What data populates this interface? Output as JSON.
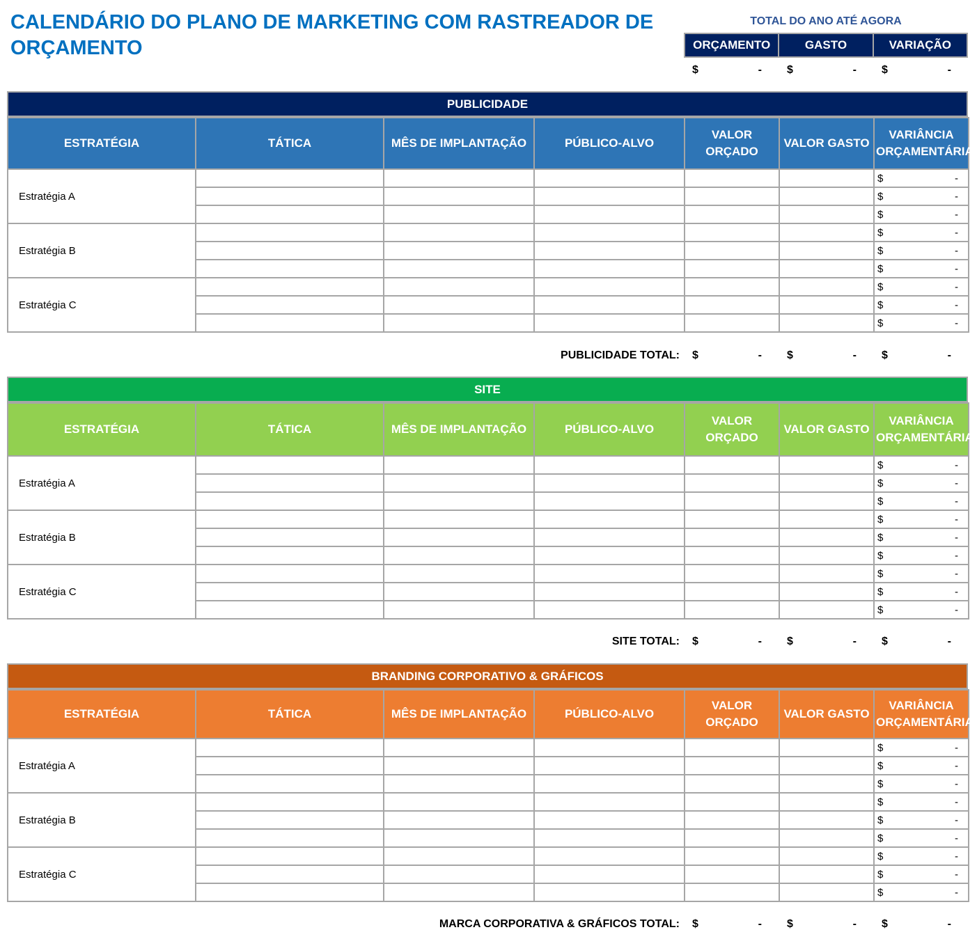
{
  "title": "CALENDÁRIO DO PLANO DE MARKETING COM RASTREADOR DE ORÇAMENTO",
  "ytd": {
    "label": "TOTAL DO ANO ATÉ AGORA",
    "headers": [
      "ORÇAMENTO",
      "GASTO",
      "VARIAÇÃO"
    ],
    "values": [
      {
        "currency": "$",
        "value": "-"
      },
      {
        "currency": "$",
        "value": "-"
      },
      {
        "currency": "$",
        "value": "-"
      }
    ]
  },
  "columns": [
    "ESTRATÉGIA",
    "TÁTICA",
    "MÊS DE IMPLANTAÇÃO",
    "PÚBLICO-ALVO",
    "VALOR ORÇADO",
    "VALOR GASTO",
    "VARIÂNCIA ORÇAMENTÁRIA"
  ],
  "colors": {
    "ytd_header": "#002060",
    "title": "#0070c0",
    "ytd_label": "#2f5597",
    "border": "#a6a6a6"
  },
  "sections": [
    {
      "name": "PUBLICIDADE",
      "banner_color": "#002060",
      "header_color": "#2e75b6",
      "strategies": [
        {
          "label": "Estratégia A",
          "rows": [
            {
              "var_currency": "$",
              "var_value": "-"
            },
            {
              "var_currency": "$",
              "var_value": "-"
            },
            {
              "var_currency": "$",
              "var_value": "-"
            }
          ]
        },
        {
          "label": "Estratégia B",
          "rows": [
            {
              "var_currency": "$",
              "var_value": "-"
            },
            {
              "var_currency": "$",
              "var_value": "-"
            },
            {
              "var_currency": "$",
              "var_value": "-"
            }
          ]
        },
        {
          "label": "Estratégia C",
          "rows": [
            {
              "var_currency": "$",
              "var_value": "-"
            },
            {
              "var_currency": "$",
              "var_value": "-"
            },
            {
              "var_currency": "$",
              "var_value": "-"
            }
          ]
        }
      ],
      "total_label": "PUBLICIDADE TOTAL:",
      "totals": [
        {
          "currency": "$",
          "value": "-"
        },
        {
          "currency": "$",
          "value": "-"
        },
        {
          "currency": "$",
          "value": "-"
        }
      ]
    },
    {
      "name": "SITE",
      "banner_color": "#08ad50",
      "header_color": "#92d050",
      "strategies": [
        {
          "label": "Estratégia A",
          "rows": [
            {
              "var_currency": "$",
              "var_value": "-"
            },
            {
              "var_currency": "$",
              "var_value": "-"
            },
            {
              "var_currency": "$",
              "var_value": "-"
            }
          ]
        },
        {
          "label": "Estratégia B",
          "rows": [
            {
              "var_currency": "$",
              "var_value": "-"
            },
            {
              "var_currency": "$",
              "var_value": "-"
            },
            {
              "var_currency": "$",
              "var_value": "-"
            }
          ]
        },
        {
          "label": "Estratégia C",
          "rows": [
            {
              "var_currency": "$",
              "var_value": "-"
            },
            {
              "var_currency": "$",
              "var_value": "-"
            },
            {
              "var_currency": "$",
              "var_value": "-"
            }
          ]
        }
      ],
      "total_label": "SITE TOTAL:",
      "totals": [
        {
          "currency": "$",
          "value": "-"
        },
        {
          "currency": "$",
          "value": "-"
        },
        {
          "currency": "$",
          "value": "-"
        }
      ]
    },
    {
      "name": "BRANDING CORPORATIVO & GRÁFICOS",
      "banner_color": "#c55a11",
      "header_color": "#ed7d31",
      "strategies": [
        {
          "label": "Estratégia A",
          "rows": [
            {
              "var_currency": "$",
              "var_value": "-"
            },
            {
              "var_currency": "$",
              "var_value": "-"
            },
            {
              "var_currency": "$",
              "var_value": "-"
            }
          ]
        },
        {
          "label": "Estratégia B",
          "rows": [
            {
              "var_currency": "$",
              "var_value": "-"
            },
            {
              "var_currency": "$",
              "var_value": "-"
            },
            {
              "var_currency": "$",
              "var_value": "-"
            }
          ]
        },
        {
          "label": "Estratégia C",
          "rows": [
            {
              "var_currency": "$",
              "var_value": "-"
            },
            {
              "var_currency": "$",
              "var_value": "-"
            },
            {
              "var_currency": "$",
              "var_value": "-"
            }
          ]
        }
      ],
      "total_label": "MARCA CORPORATIVA & GRÁFICOS TOTAL:",
      "totals": [
        {
          "currency": "$",
          "value": "-"
        },
        {
          "currency": "$",
          "value": "-"
        },
        {
          "currency": "$",
          "value": "-"
        }
      ]
    }
  ]
}
